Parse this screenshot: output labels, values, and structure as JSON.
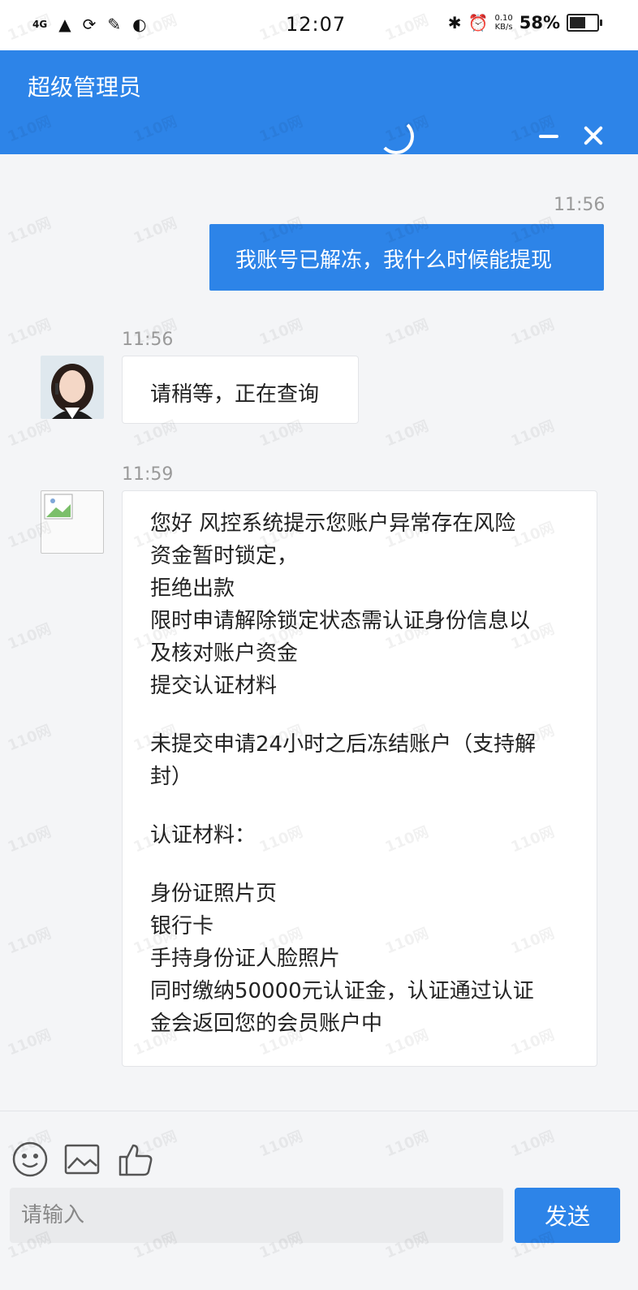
{
  "status_bar": {
    "signal_text": "4G",
    "time": "12:07",
    "net_speed_value": "0.10",
    "net_speed_unit": "KB/s",
    "battery_percent": "58%",
    "battery_level": 0.58
  },
  "header": {
    "title": "超级管理员"
  },
  "messages": {
    "me_time": "11:56",
    "me_text": "我账号已解冻，我什么时候能提现",
    "reply1_time": "11:56",
    "reply1_text": "请稍等，正在查询",
    "reply2_time": "11:59",
    "reply2_lines": [
      "您好 风控系统提示您账户异常存在风险",
      "资金暂时锁定，",
      "拒绝出款",
      "限时申请解除锁定状态需认证身份信息以",
      "及核对账户资金",
      "提交认证材料",
      "",
      "未提交申请24小时之后冻结账户（支持解",
      "封）",
      "",
      "认证材料：",
      "",
      "身份证照片页",
      "银行卡",
      "手持身份证人脸照片",
      "同时缴纳50000元认证金，认证通过认证",
      "金会返回您的会员账户中"
    ]
  },
  "composer": {
    "placeholder": "请输入",
    "send_label": "发送",
    "icons": [
      "emoji-icon",
      "image-icon",
      "thumbs-up-icon"
    ]
  },
  "watermark": "110网",
  "colors": {
    "brand_blue": "#2d84e8",
    "page_bg": "#f4f5f7"
  }
}
